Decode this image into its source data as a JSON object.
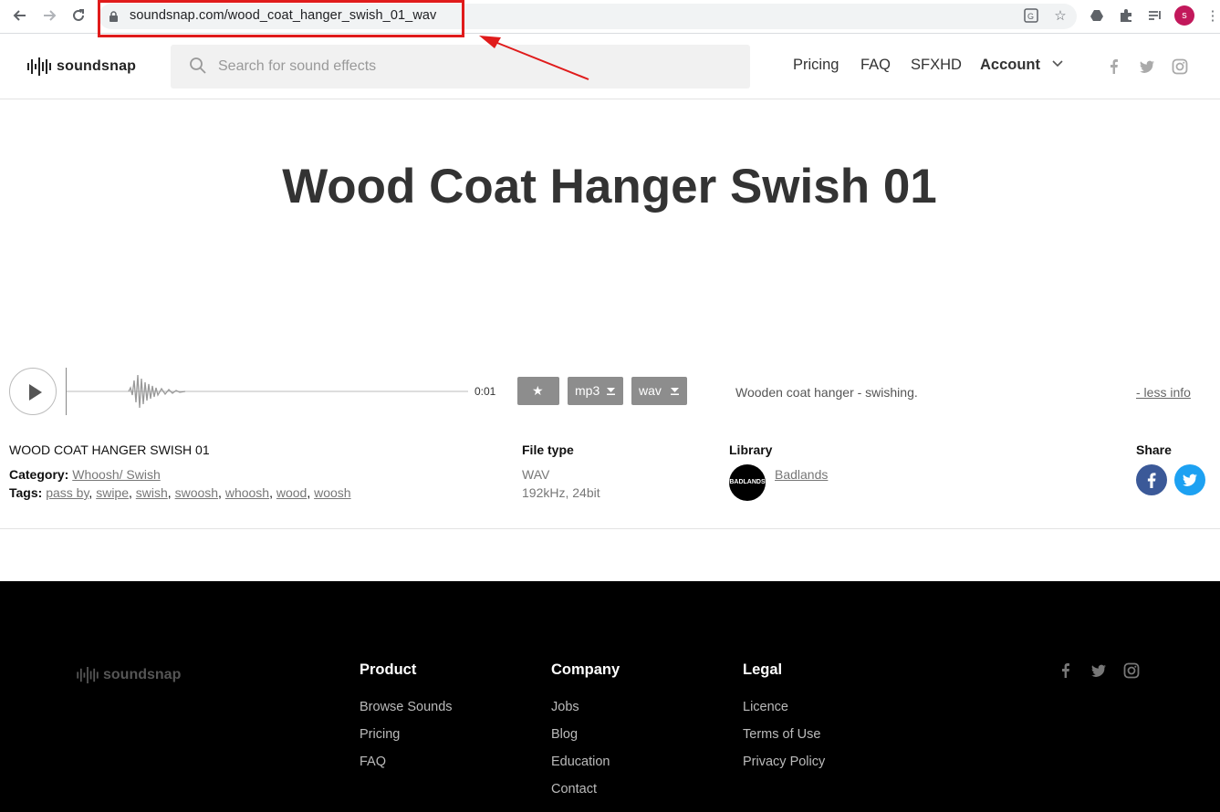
{
  "browser": {
    "url": "soundsnap.com/wood_coat_hanger_swish_01_wav",
    "profile_initial": "s"
  },
  "header": {
    "logo_text": "soundsnap",
    "search_placeholder": "Search for sound effects",
    "nav": [
      "Pricing",
      "FAQ",
      "SFXHD",
      "Account"
    ]
  },
  "sound": {
    "title": "Wood Coat Hanger Swish 01",
    "duration": "0:01",
    "formats": [
      "mp3",
      "wav"
    ],
    "favorite_label": "★",
    "description": "Wooden coat hanger - swishing.",
    "less_info": "- less info",
    "name_caps": "WOOD COAT HANGER SWISH 01",
    "category_label": "Category:",
    "category": "Whoosh/ Swish",
    "tags_label": "Tags:",
    "tags": [
      "pass by",
      "swipe",
      "swish",
      "swoosh",
      "whoosh",
      "wood",
      "woosh"
    ],
    "file_type_label": "File type",
    "file_type": "WAV",
    "file_spec": "192kHz, 24bit",
    "library_label": "Library",
    "library": "Badlands",
    "library_avatar_text": "BADLANDS",
    "share_label": "Share"
  },
  "footer": {
    "logo_text": "soundsnap",
    "product": {
      "title": "Product",
      "links": [
        "Browse Sounds",
        "Pricing",
        "FAQ"
      ]
    },
    "company": {
      "title": "Company",
      "links": [
        "Jobs",
        "Blog",
        "Education",
        "Contact"
      ]
    },
    "legal": {
      "title": "Legal",
      "links": [
        "Licence",
        "Terms of Use",
        "Privacy Policy"
      ]
    }
  },
  "colors": {
    "annotation_red": "#e01b1b",
    "facebook": "#3b5998",
    "twitter": "#1da1f2",
    "button_grey": "#8d8d8d",
    "footer_bg": "#000000"
  }
}
